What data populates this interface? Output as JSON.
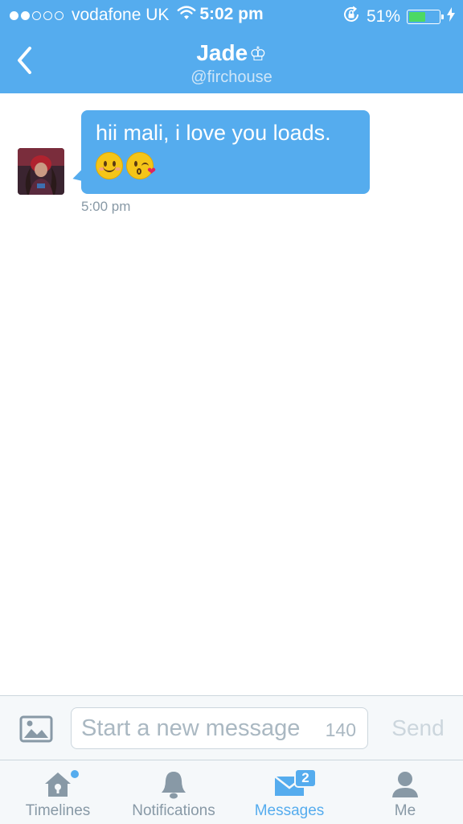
{
  "status_bar": {
    "carrier": "vodafone UK",
    "time": "5:02 pm",
    "battery_percent": "51%",
    "battery_level": 0.51,
    "signal_bars_filled": 2,
    "signal_bars_total": 5
  },
  "header": {
    "title": "Jade",
    "title_symbol": "♔",
    "handle": "@firchouse",
    "back_icon": "chevron-left-icon"
  },
  "conversation": {
    "messages": [
      {
        "text": "hii mali, i love you loads.",
        "emojis": [
          "smiling-face-emoji",
          "face-blowing-kiss-emoji"
        ],
        "time": "5:00 pm"
      }
    ]
  },
  "composer": {
    "placeholder": "Start a new message",
    "char_count": "140",
    "send_label": "Send",
    "media_icon": "photo-icon"
  },
  "tabs": [
    {
      "label": "Timelines",
      "icon": "home-icon",
      "active": false,
      "has_new_dot": true
    },
    {
      "label": "Notifications",
      "icon": "bell-icon",
      "active": false
    },
    {
      "label": "Messages",
      "icon": "envelope-icon",
      "active": true,
      "badge": "2"
    },
    {
      "label": "Me",
      "icon": "person-icon",
      "active": false
    }
  ],
  "colors": {
    "brand_blue": "#55acee",
    "battery_green": "#4cd964",
    "inactive_gray": "#8899a6"
  }
}
